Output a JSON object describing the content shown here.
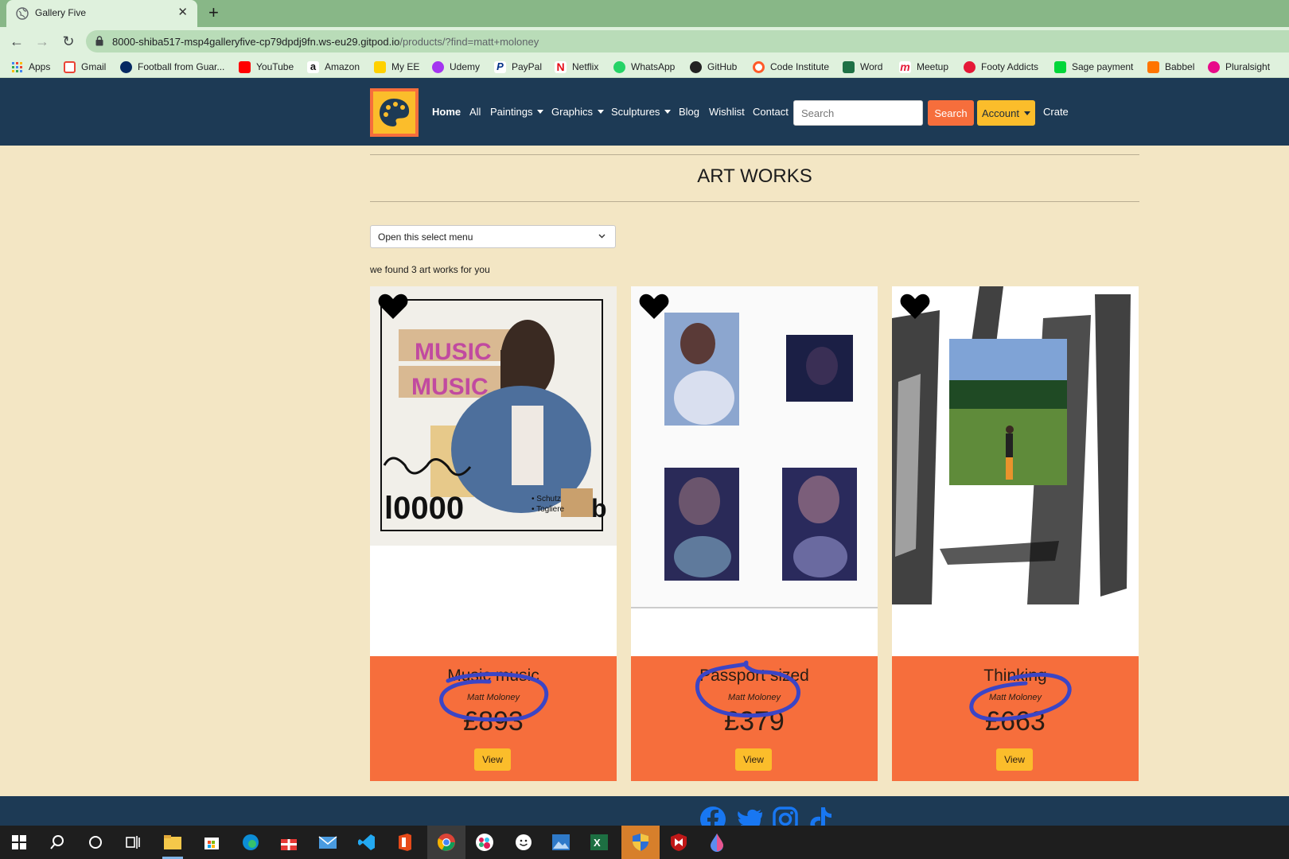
{
  "browser": {
    "tab_title": "Gallery Five",
    "new_tab_symbol": "+",
    "url_host": "8000-shiba517-msp4galleryfive-cp79dpdj9fn.ws-eu29.gitpod.io",
    "url_path": "/products/?find=matt+moloney",
    "bookmarks": [
      "Apps",
      "Gmail",
      "Football from Guar...",
      "YouTube",
      "Amazon",
      "My EE",
      "Udemy",
      "PayPal",
      "Netflix",
      "WhatsApp",
      "GitHub",
      "Code Institute",
      "Word",
      "Meetup",
      "Footy Addicts",
      "Sage payment",
      "Babbel",
      "Pluralsight"
    ]
  },
  "nav": {
    "home": "Home",
    "all": "All",
    "paintings": "Paintings",
    "graphics": "Graphics",
    "sculptures": "Sculptures",
    "blog": "Blog",
    "wishlist": "Wishlist",
    "contact": "Contact",
    "search_placeholder": "Search",
    "search_button": "Search",
    "account": "Account",
    "crate": "Crate"
  },
  "main": {
    "title": "ART WORKS",
    "sort_select": "Open this select menu",
    "results_text": "we found 3 art works for you",
    "products": [
      {
        "title": "Music music",
        "artist": "Matt Moloney",
        "price": "£893",
        "view_label": "View"
      },
      {
        "title": "Passport sized",
        "artist": "Matt Moloney",
        "price": "£379",
        "view_label": "View"
      },
      {
        "title": "Thinking",
        "artist": "Matt Moloney",
        "price": "£663",
        "view_label": "View"
      }
    ]
  },
  "colors": {
    "header_bg": "#1d3a55",
    "page_bg": "#f3e6c4",
    "accent_orange": "#f66e3c",
    "accent_yellow": "#fbbd2b",
    "annotation_ink": "#3b45c6"
  },
  "icons": {
    "wishlist": "heart-icon",
    "footer_social": [
      "facebook-icon",
      "twitter-icon",
      "instagram-icon",
      "tiktok-icon"
    ]
  }
}
